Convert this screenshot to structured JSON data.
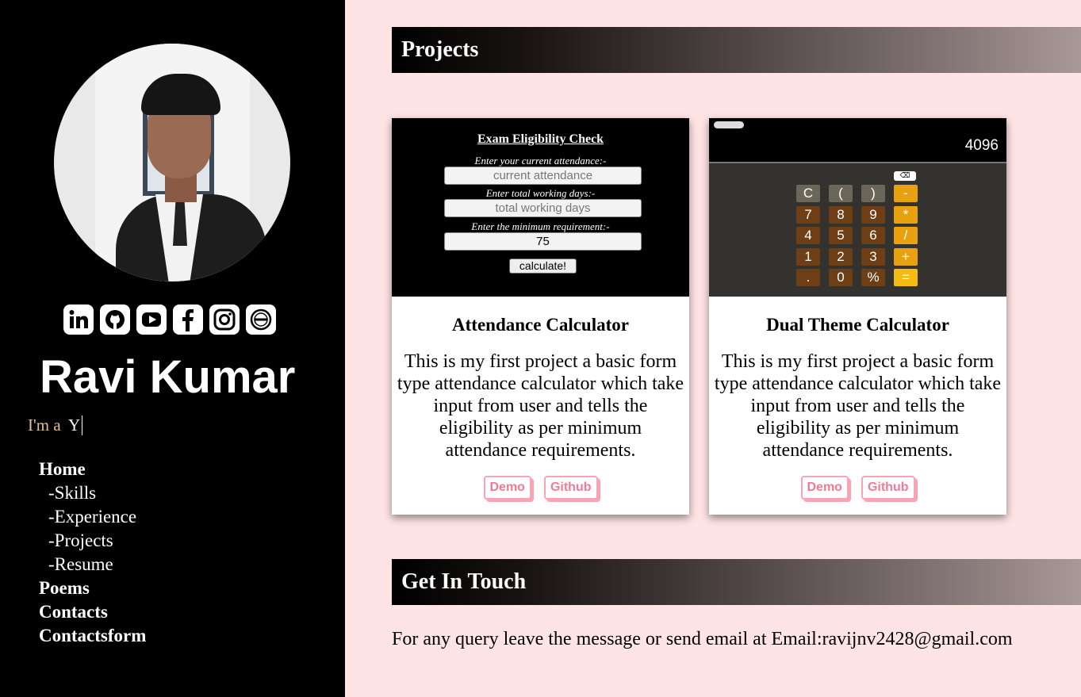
{
  "sidebar": {
    "name": "Ravi Kumar",
    "tagline_prefix": "I'm a",
    "tagline_typed": "Y",
    "social": [
      "linkedin-icon",
      "github-icon",
      "youtube-icon",
      "facebook-icon",
      "instagram-icon",
      "flowcode-icon"
    ],
    "nav": [
      {
        "label": "Home",
        "level": "main"
      },
      {
        "label": "-Skills",
        "level": "sub"
      },
      {
        "label": "-Experience",
        "level": "sub"
      },
      {
        "label": "-Projects",
        "level": "sub"
      },
      {
        "label": "-Resume",
        "level": "sub"
      },
      {
        "label": "Poems",
        "level": "main"
      },
      {
        "label": "Contacts",
        "level": "main"
      },
      {
        "label": "Contactsform",
        "level": "main"
      }
    ]
  },
  "projects": {
    "heading": "Projects",
    "cards": [
      {
        "title": "Attendance Calculator",
        "description": "This is my first project a basic form type attendance calculator which take input from user and tells the eligibility as per minimum attendance requirements.",
        "demo_label": "Demo",
        "github_label": "Github",
        "thumb": {
          "title": "Exam Eligibility Check",
          "label1": "Enter your current attendance:-",
          "field1": "current attendance",
          "label2": "Enter total working days:-",
          "field2": "total working days",
          "label3": "Enter the minimum requirement:-",
          "field3": "75",
          "button": "calculate!"
        }
      },
      {
        "title": "Dual Theme Calculator",
        "description": "This is my first project a basic form type attendance calculator which take input from user and tells the eligibility as per minimum attendance requirements.",
        "demo_label": "Demo",
        "github_label": "Github",
        "thumb": {
          "display": "4096",
          "backspace": "⌫",
          "keys": [
            "C",
            "(",
            ")",
            "-",
            "7",
            "8",
            "9",
            "*",
            "4",
            "5",
            "6",
            "/",
            "1",
            "2",
            "3",
            "+",
            ".",
            "0",
            "%",
            "="
          ]
        }
      }
    ]
  },
  "contact": {
    "heading": "Get In Touch",
    "text": "For any query leave the message or send email at Email:ravijnv2428@gmail.com"
  },
  "colors": {
    "sidebar_bg": "#000000",
    "page_bg": "#ffe4e6",
    "accent_pink": "#f27a95",
    "calc_operator": "#e8a210",
    "calc_number": "#6e3f14"
  }
}
